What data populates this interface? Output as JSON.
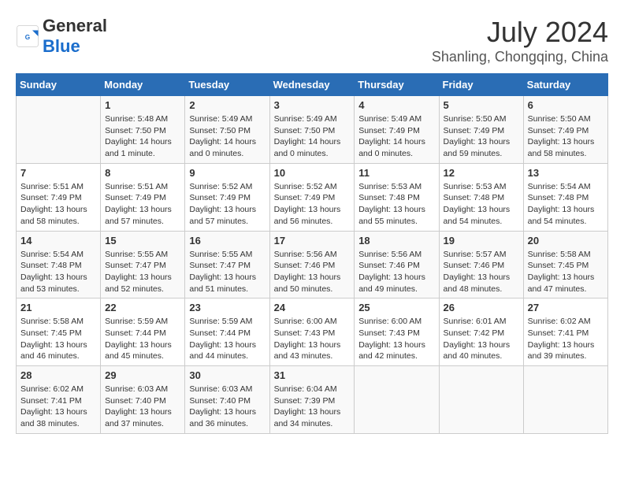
{
  "header": {
    "logo_general": "General",
    "logo_blue": "Blue",
    "month_year": "July 2024",
    "location": "Shanling, Chongqing, China"
  },
  "weekdays": [
    "Sunday",
    "Monday",
    "Tuesday",
    "Wednesday",
    "Thursday",
    "Friday",
    "Saturday"
  ],
  "weeks": [
    [
      {
        "day": "",
        "info": ""
      },
      {
        "day": "1",
        "info": "Sunrise: 5:48 AM\nSunset: 7:50 PM\nDaylight: 14 hours\nand 1 minute."
      },
      {
        "day": "2",
        "info": "Sunrise: 5:49 AM\nSunset: 7:50 PM\nDaylight: 14 hours\nand 0 minutes."
      },
      {
        "day": "3",
        "info": "Sunrise: 5:49 AM\nSunset: 7:50 PM\nDaylight: 14 hours\nand 0 minutes."
      },
      {
        "day": "4",
        "info": "Sunrise: 5:49 AM\nSunset: 7:49 PM\nDaylight: 14 hours\nand 0 minutes."
      },
      {
        "day": "5",
        "info": "Sunrise: 5:50 AM\nSunset: 7:49 PM\nDaylight: 13 hours\nand 59 minutes."
      },
      {
        "day": "6",
        "info": "Sunrise: 5:50 AM\nSunset: 7:49 PM\nDaylight: 13 hours\nand 58 minutes."
      }
    ],
    [
      {
        "day": "7",
        "info": "Sunrise: 5:51 AM\nSunset: 7:49 PM\nDaylight: 13 hours\nand 58 minutes."
      },
      {
        "day": "8",
        "info": "Sunrise: 5:51 AM\nSunset: 7:49 PM\nDaylight: 13 hours\nand 57 minutes."
      },
      {
        "day": "9",
        "info": "Sunrise: 5:52 AM\nSunset: 7:49 PM\nDaylight: 13 hours\nand 57 minutes."
      },
      {
        "day": "10",
        "info": "Sunrise: 5:52 AM\nSunset: 7:49 PM\nDaylight: 13 hours\nand 56 minutes."
      },
      {
        "day": "11",
        "info": "Sunrise: 5:53 AM\nSunset: 7:48 PM\nDaylight: 13 hours\nand 55 minutes."
      },
      {
        "day": "12",
        "info": "Sunrise: 5:53 AM\nSunset: 7:48 PM\nDaylight: 13 hours\nand 54 minutes."
      },
      {
        "day": "13",
        "info": "Sunrise: 5:54 AM\nSunset: 7:48 PM\nDaylight: 13 hours\nand 54 minutes."
      }
    ],
    [
      {
        "day": "14",
        "info": "Sunrise: 5:54 AM\nSunset: 7:48 PM\nDaylight: 13 hours\nand 53 minutes."
      },
      {
        "day": "15",
        "info": "Sunrise: 5:55 AM\nSunset: 7:47 PM\nDaylight: 13 hours\nand 52 minutes."
      },
      {
        "day": "16",
        "info": "Sunrise: 5:55 AM\nSunset: 7:47 PM\nDaylight: 13 hours\nand 51 minutes."
      },
      {
        "day": "17",
        "info": "Sunrise: 5:56 AM\nSunset: 7:46 PM\nDaylight: 13 hours\nand 50 minutes."
      },
      {
        "day": "18",
        "info": "Sunrise: 5:56 AM\nSunset: 7:46 PM\nDaylight: 13 hours\nand 49 minutes."
      },
      {
        "day": "19",
        "info": "Sunrise: 5:57 AM\nSunset: 7:46 PM\nDaylight: 13 hours\nand 48 minutes."
      },
      {
        "day": "20",
        "info": "Sunrise: 5:58 AM\nSunset: 7:45 PM\nDaylight: 13 hours\nand 47 minutes."
      }
    ],
    [
      {
        "day": "21",
        "info": "Sunrise: 5:58 AM\nSunset: 7:45 PM\nDaylight: 13 hours\nand 46 minutes."
      },
      {
        "day": "22",
        "info": "Sunrise: 5:59 AM\nSunset: 7:44 PM\nDaylight: 13 hours\nand 45 minutes."
      },
      {
        "day": "23",
        "info": "Sunrise: 5:59 AM\nSunset: 7:44 PM\nDaylight: 13 hours\nand 44 minutes."
      },
      {
        "day": "24",
        "info": "Sunrise: 6:00 AM\nSunset: 7:43 PM\nDaylight: 13 hours\nand 43 minutes."
      },
      {
        "day": "25",
        "info": "Sunrise: 6:00 AM\nSunset: 7:43 PM\nDaylight: 13 hours\nand 42 minutes."
      },
      {
        "day": "26",
        "info": "Sunrise: 6:01 AM\nSunset: 7:42 PM\nDaylight: 13 hours\nand 40 minutes."
      },
      {
        "day": "27",
        "info": "Sunrise: 6:02 AM\nSunset: 7:41 PM\nDaylight: 13 hours\nand 39 minutes."
      }
    ],
    [
      {
        "day": "28",
        "info": "Sunrise: 6:02 AM\nSunset: 7:41 PM\nDaylight: 13 hours\nand 38 minutes."
      },
      {
        "day": "29",
        "info": "Sunrise: 6:03 AM\nSunset: 7:40 PM\nDaylight: 13 hours\nand 37 minutes."
      },
      {
        "day": "30",
        "info": "Sunrise: 6:03 AM\nSunset: 7:40 PM\nDaylight: 13 hours\nand 36 minutes."
      },
      {
        "day": "31",
        "info": "Sunrise: 6:04 AM\nSunset: 7:39 PM\nDaylight: 13 hours\nand 34 minutes."
      },
      {
        "day": "",
        "info": ""
      },
      {
        "day": "",
        "info": ""
      },
      {
        "day": "",
        "info": ""
      }
    ]
  ]
}
